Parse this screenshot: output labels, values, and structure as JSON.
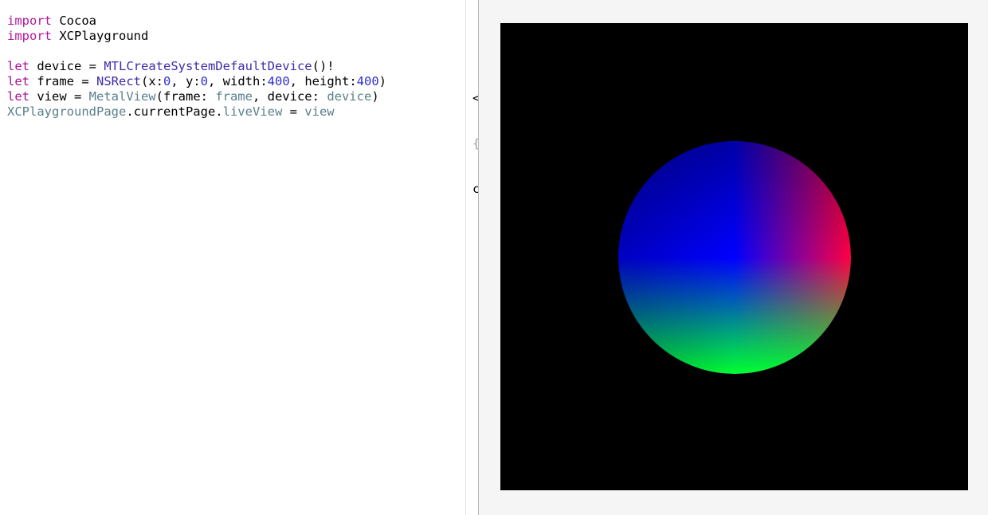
{
  "editor": {
    "lines": [
      [
        {
          "t": "import",
          "c": "kw"
        },
        {
          "t": " Cocoa",
          "c": "pl"
        }
      ],
      [
        {
          "t": "import",
          "c": "kw"
        },
        {
          "t": " XCPlayground",
          "c": "pl"
        }
      ],
      [],
      [
        {
          "t": "let",
          "c": "kw2"
        },
        {
          "t": " device = ",
          "c": "pl"
        },
        {
          "t": "MTLCreateSystemDefaultDevice",
          "c": "fn"
        },
        {
          "t": "()!",
          "c": "pl"
        }
      ],
      [
        {
          "t": "let",
          "c": "kw2"
        },
        {
          "t": " frame = ",
          "c": "pl"
        },
        {
          "t": "NSRect",
          "c": "fn"
        },
        {
          "t": "(x:",
          "c": "pl"
        },
        {
          "t": "0",
          "c": "num"
        },
        {
          "t": ", y:",
          "c": "pl"
        },
        {
          "t": "0",
          "c": "num"
        },
        {
          "t": ", width:",
          "c": "pl"
        },
        {
          "t": "400",
          "c": "num"
        },
        {
          "t": ", height:",
          "c": "pl"
        },
        {
          "t": "400",
          "c": "num"
        },
        {
          "t": ")",
          "c": "pl"
        }
      ],
      [
        {
          "t": "let",
          "c": "kw2"
        },
        {
          "t": " view = ",
          "c": "pl"
        },
        {
          "t": "MetalView",
          "c": "ty"
        },
        {
          "t": "(frame: ",
          "c": "pl"
        },
        {
          "t": "frame",
          "c": "ty"
        },
        {
          "t": ", device: ",
          "c": "pl"
        },
        {
          "t": "device",
          "c": "ty"
        },
        {
          "t": ")",
          "c": "pl"
        }
      ],
      [
        {
          "t": "XCPlaygroundPage",
          "c": "ty"
        },
        {
          "t": ".currentPage.",
          "c": "pl"
        },
        {
          "t": "liveView",
          "c": "ty"
        },
        {
          "t": " = ",
          "c": "pl"
        },
        {
          "t": "view",
          "c": "ty"
        }
      ]
    ]
  },
  "results_gutter": {
    "line1": "<",
    "line2": "{",
    "line3": "c"
  },
  "live_view": {
    "background": "#000000",
    "sphere_colors": {
      "left": "#0000ff",
      "right": "#ff0050",
      "bottom": "#00ff30",
      "top": "#000000"
    }
  }
}
